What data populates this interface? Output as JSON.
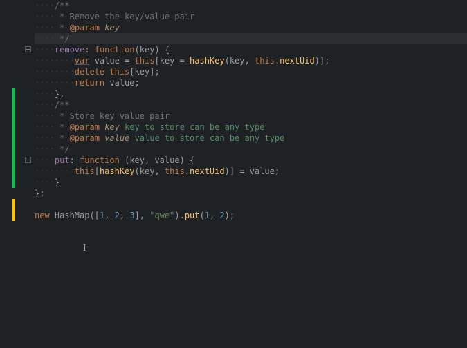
{
  "lines": [
    {
      "indent": 1,
      "tokens": [
        [
          "comment",
          "/**"
        ]
      ]
    },
    {
      "indent": 1,
      "tokens": [
        [
          "comment",
          " * Remove the key/value pair"
        ]
      ]
    },
    {
      "indent": 1,
      "tokens": [
        [
          "comment",
          " * "
        ],
        [
          "doc-tag",
          "@param"
        ],
        [
          "comment",
          " "
        ],
        [
          "doc-param",
          "key"
        ]
      ]
    },
    {
      "indent": 1,
      "tokens": [
        [
          "comment",
          " */"
        ]
      ],
      "active": true
    },
    {
      "indent": 1,
      "tokens": [
        [
          "prop",
          "remove"
        ],
        [
          "punc",
          ": "
        ],
        [
          "func-decl",
          "function"
        ],
        [
          "paren",
          "("
        ],
        [
          "ident",
          "key"
        ],
        [
          "paren",
          ") "
        ],
        [
          "brace",
          "{"
        ]
      ],
      "fold": true
    },
    {
      "indent": 2,
      "tokens": [
        [
          "keyword-var",
          "var"
        ],
        [
          "ident",
          " value "
        ],
        [
          "op",
          "= "
        ],
        [
          "this",
          "this"
        ],
        [
          "paren",
          "["
        ],
        [
          "ident",
          "key "
        ],
        [
          "op",
          "= "
        ],
        [
          "method",
          "hashKey"
        ],
        [
          "paren",
          "("
        ],
        [
          "ident",
          "key"
        ],
        [
          "punc",
          ", "
        ],
        [
          "this",
          "this"
        ],
        [
          "punc",
          "."
        ],
        [
          "method",
          "nextUid"
        ],
        [
          "paren",
          ")]"
        ],
        [
          "punc",
          ";"
        ]
      ]
    },
    {
      "indent": 2,
      "tokens": [
        [
          "keyword",
          "delete "
        ],
        [
          "this",
          "this"
        ],
        [
          "paren",
          "["
        ],
        [
          "ident",
          "key"
        ],
        [
          "paren",
          "]"
        ],
        [
          "punc",
          ";"
        ]
      ]
    },
    {
      "indent": 2,
      "tokens": [
        [
          "keyword",
          "return "
        ],
        [
          "ident",
          "value"
        ],
        [
          "punc",
          ";"
        ]
      ]
    },
    {
      "indent": 1,
      "tokens": [
        [
          "brace",
          "}"
        ],
        [
          "punc",
          ","
        ]
      ]
    },
    {
      "indent": 1,
      "tokens": [
        [
          "comment",
          "/**"
        ]
      ]
    },
    {
      "indent": 1,
      "tokens": [
        [
          "comment",
          " * Store key value pair"
        ]
      ]
    },
    {
      "indent": 1,
      "tokens": [
        [
          "comment",
          " * "
        ],
        [
          "doc-tag",
          "@param"
        ],
        [
          "comment",
          " "
        ],
        [
          "doc-param",
          "key"
        ],
        [
          "comment",
          " "
        ],
        [
          "doc-desc",
          "key to store can be any type"
        ]
      ]
    },
    {
      "indent": 1,
      "tokens": [
        [
          "comment",
          " * "
        ],
        [
          "doc-tag",
          "@param"
        ],
        [
          "comment",
          " "
        ],
        [
          "doc-param",
          "value"
        ],
        [
          "comment",
          " "
        ],
        [
          "doc-desc",
          "value to store can be any type"
        ]
      ]
    },
    {
      "indent": 1,
      "tokens": [
        [
          "comment",
          " */"
        ]
      ]
    },
    {
      "indent": 1,
      "tokens": [
        [
          "prop",
          "put"
        ],
        [
          "punc",
          ": "
        ],
        [
          "func-decl",
          "function"
        ],
        [
          "ident",
          " "
        ],
        [
          "paren",
          "("
        ],
        [
          "ident",
          "key"
        ],
        [
          "punc",
          ", "
        ],
        [
          "ident",
          "value"
        ],
        [
          "paren",
          ") "
        ],
        [
          "brace",
          "{"
        ]
      ],
      "fold": true
    },
    {
      "indent": 2,
      "tokens": [
        [
          "this",
          "this"
        ],
        [
          "paren",
          "["
        ],
        [
          "method",
          "hashKey"
        ],
        [
          "paren",
          "("
        ],
        [
          "ident",
          "key"
        ],
        [
          "punc",
          ", "
        ],
        [
          "this",
          "this"
        ],
        [
          "punc",
          "."
        ],
        [
          "method",
          "nextUid"
        ],
        [
          "paren",
          ")] "
        ],
        [
          "op",
          "= "
        ],
        [
          "ident",
          "value"
        ],
        [
          "punc",
          ";"
        ]
      ]
    },
    {
      "indent": 1,
      "tokens": [
        [
          "brace",
          "}"
        ]
      ]
    },
    {
      "indent": 0,
      "tokens": [
        [
          "brace",
          "}"
        ],
        [
          "punc",
          ";"
        ]
      ]
    },
    {
      "indent": 0,
      "tokens": []
    },
    {
      "indent": 0,
      "tokens": [
        [
          "keyword",
          "new "
        ],
        [
          "class-name",
          "HashMap"
        ],
        [
          "paren",
          "(["
        ],
        [
          "num",
          "1"
        ],
        [
          "punc",
          ", "
        ],
        [
          "num",
          "2"
        ],
        [
          "punc",
          ", "
        ],
        [
          "num",
          "3"
        ],
        [
          "paren",
          "]"
        ],
        [
          "punc",
          ", "
        ],
        [
          "str",
          "\"qwe\""
        ],
        [
          "paren",
          ")"
        ],
        [
          "punc",
          "."
        ],
        [
          "method",
          "put"
        ],
        [
          "paren",
          "("
        ],
        [
          "num",
          "1"
        ],
        [
          "punc",
          ", "
        ],
        [
          "num",
          "2"
        ],
        [
          "paren",
          ")"
        ],
        [
          "punc",
          ";"
        ]
      ]
    }
  ],
  "changeBars": [
    {
      "row": 8,
      "rows": 9,
      "cls": "change-green"
    },
    {
      "row": 18,
      "rows": 2,
      "cls": "change-yellow"
    }
  ],
  "cursor": {
    "row": 22,
    "col": 10
  }
}
